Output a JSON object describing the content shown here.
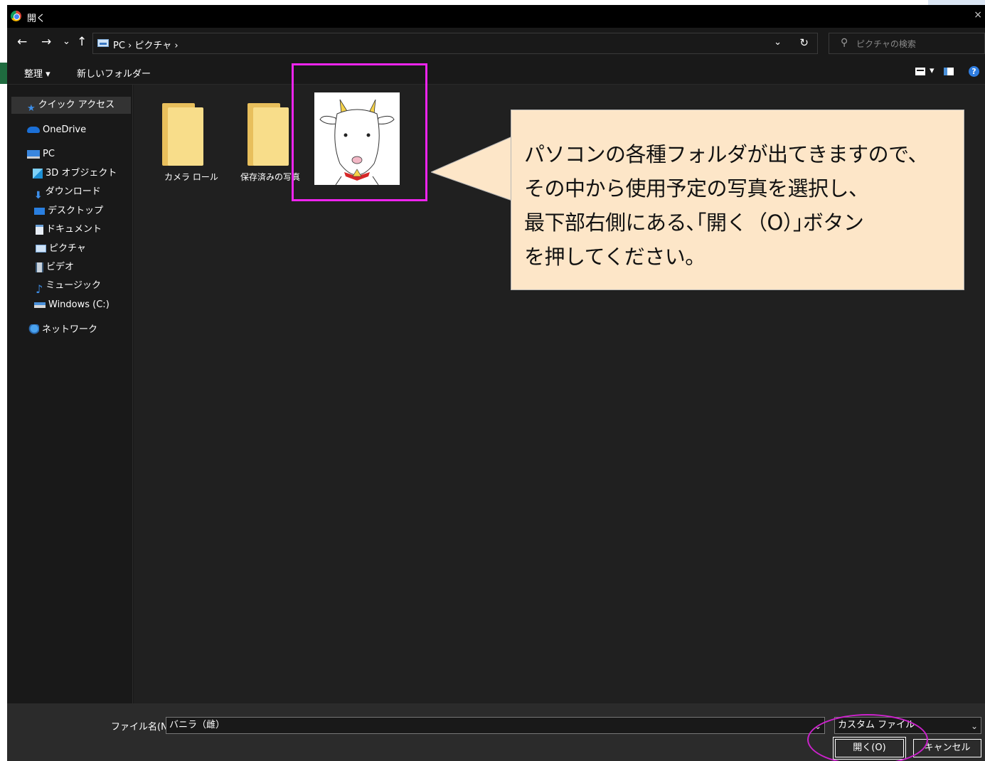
{
  "window": {
    "title": "開く",
    "close_glyph": "×"
  },
  "nav": {
    "back": "←",
    "forward": "→",
    "recent": "⌄",
    "up": "↑",
    "address": "PC › ピクチャ ›",
    "address_sep": "›",
    "dropdown": "⌄",
    "refresh": "↻",
    "search_placeholder": "ピクチャの検索",
    "search_glyph": "⚲"
  },
  "toolbar": {
    "organize": "整理 ▾",
    "new_folder": "新しいフォルダー",
    "view_drop": "▾",
    "help": "?"
  },
  "sidebar": {
    "items": [
      {
        "label": "クイック アクセス",
        "icon": "star-icon"
      },
      {
        "label": "OneDrive",
        "icon": "cloud-icon"
      },
      {
        "label": "PC",
        "icon": "pc-icon"
      },
      {
        "label": "3D オブジェクト",
        "icon": "cube-icon"
      },
      {
        "label": "ダウンロード",
        "icon": "download-icon"
      },
      {
        "label": "デスクトップ",
        "icon": "desktop-icon"
      },
      {
        "label": "ドキュメント",
        "icon": "document-icon"
      },
      {
        "label": "ピクチャ",
        "icon": "pictures-icon"
      },
      {
        "label": "ビデオ",
        "icon": "video-icon"
      },
      {
        "label": "ミュージック",
        "icon": "music-icon"
      },
      {
        "label": "Windows (C:)",
        "icon": "drive-icon"
      },
      {
        "label": "ネットワーク",
        "icon": "network-icon"
      }
    ]
  },
  "files": [
    {
      "label": "カメラ ロール",
      "type": "folder"
    },
    {
      "label": "保存済みの写真",
      "type": "folder"
    },
    {
      "label": "",
      "type": "image"
    }
  ],
  "bottom": {
    "filename_label": "ファイル名(N):",
    "filename_value": "バニラ（雌）",
    "filetype_value": "カスタム ファイル",
    "open_button": "開く(O)",
    "cancel_button": "キャンセル",
    "drop_glyph": "⌄"
  },
  "callout": {
    "text": "パソコンの各種フォルダが出てきますので、\nその中から使用予定の写真を選択し、\n最下部右側にある､｢開く（O）｣ボタン\nを押してください。"
  },
  "colors": {
    "annotation": "#ee24ee",
    "callout_bg": "#fde6c8",
    "folder": "#f8dd8a"
  }
}
